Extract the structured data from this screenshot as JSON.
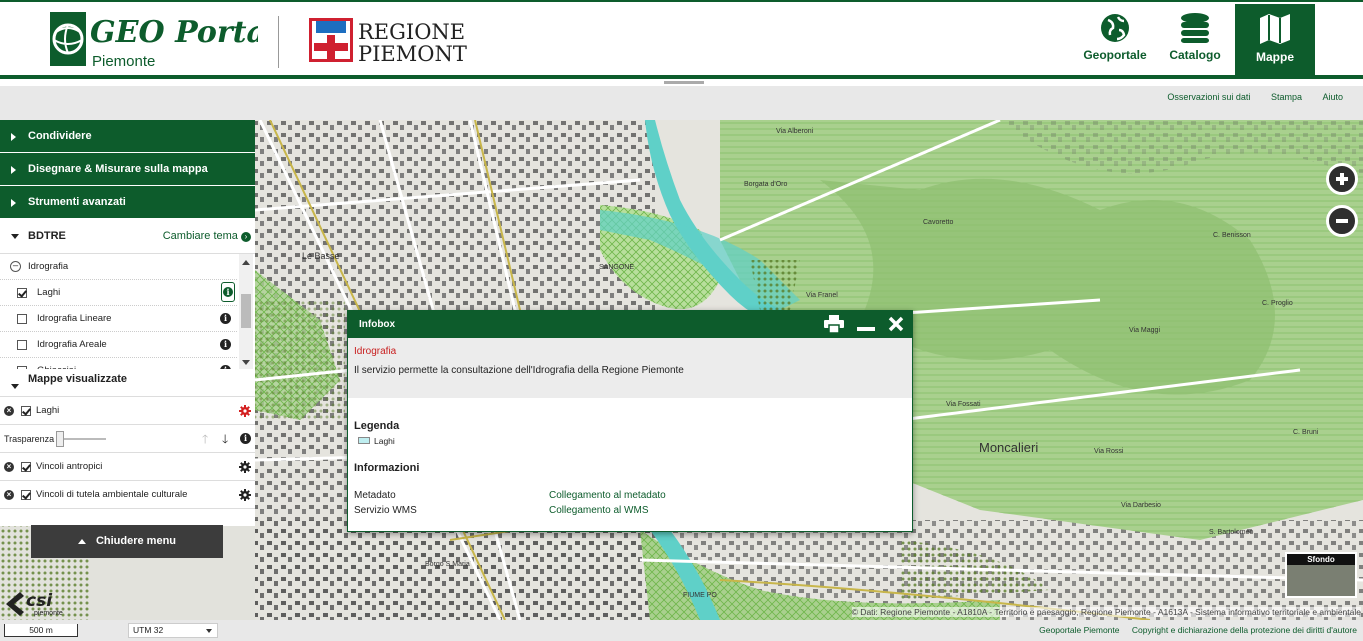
{
  "header": {
    "logo_geo_main": "GEO Portale",
    "logo_geo_sub": "Piemonte",
    "logo_region_line1": "REGIONE",
    "logo_region_line2": "PIEMONTE",
    "nav": [
      {
        "label": "Geoportale",
        "icon": "globe-icon"
      },
      {
        "label": "Catalogo",
        "icon": "database-icon"
      },
      {
        "label": "Mappe",
        "icon": "map-icon",
        "active": true
      }
    ]
  },
  "toolbar_links": [
    "Osservazioni sui dati",
    "Stampa",
    "Aiuto"
  ],
  "sidebar": {
    "accordions": [
      "Condividere",
      "Disegnare & Misurare sulla mappa",
      "Strumenti avanzati"
    ],
    "theme_title": "BDTRE",
    "theme_link": "Cambiare tema",
    "group": "Idrografia",
    "layers": [
      {
        "label": "Laghi",
        "checked": true
      },
      {
        "label": "Idrografia Lineare",
        "checked": false
      },
      {
        "label": "Idrografia Areale",
        "checked": false
      },
      {
        "label": "Ghiacciai",
        "checked": false
      }
    ],
    "visible_title": "Mappe visualizzate",
    "visible_maps": [
      {
        "label": "Laghi",
        "gear_color": "#d42020"
      },
      {
        "label": "Vincoli antropici",
        "gear_color": "#222222"
      },
      {
        "label": "Vincoli di tutela ambientale culturale",
        "gear_color": "#222222"
      }
    ],
    "transparency_label": "Trasparenza",
    "close_menu": "Chiudere menu"
  },
  "infobox": {
    "title": "Infobox",
    "layer_title": "Idrografia",
    "description": "Il servizio permette la consultazione dell'Idrografia della Regione Piemonte",
    "legend_heading": "Legenda",
    "legend_item": "Laghi",
    "info_heading": "Informazioni",
    "rows": [
      {
        "label": "Metadato",
        "link": "Collegamento al metadato"
      },
      {
        "label": "Servizio WMS",
        "link": "Collegamento al WMS"
      }
    ]
  },
  "map": {
    "labels": {
      "le_basse": "Le Basse",
      "moncalieri": "Moncalieri",
      "sangone": "SANGONE",
      "via_rossi": "Via Rossi",
      "via_maggi": "Via Maggi",
      "via_fossati": "Via Fossati",
      "cavoretto": "Cavoretto",
      "fiume_po": "FIUME   PO",
      "via_franel": "Via Franel",
      "via_alberoni": "Via Alberoni",
      "borgata_oro": "Borgata d'Oro",
      "cenisso": "C. Benisson",
      "strada_maria": "Borgo S.Maria",
      "s_bartolomeo": "S. Bartolomeo",
      "proglio": "C. Proglio",
      "via_darbesio": "Via Darbesio",
      "bruni": "C. Bruni"
    },
    "sfondo": "Sfondo",
    "attribution": "© Dati: Regione Piemonte - A1810A - Territorio e paesaggio, Regione Piemonte - A1613A - Sistema informativo territoriale e ambientale",
    "scale": "500 m",
    "projection": "UTM 32",
    "footer_links": [
      "Geoportale Piemonte",
      "Copyright e dichiarazione della protezione dei diritti d'autore"
    ]
  },
  "branding": {
    "csi": "csi",
    "csi_sub": "piemonte"
  },
  "colors": {
    "primary": "#0d5c2c",
    "alert": "#c81e1e",
    "forest": "#a9d08e",
    "water": "#5fd0c8"
  }
}
